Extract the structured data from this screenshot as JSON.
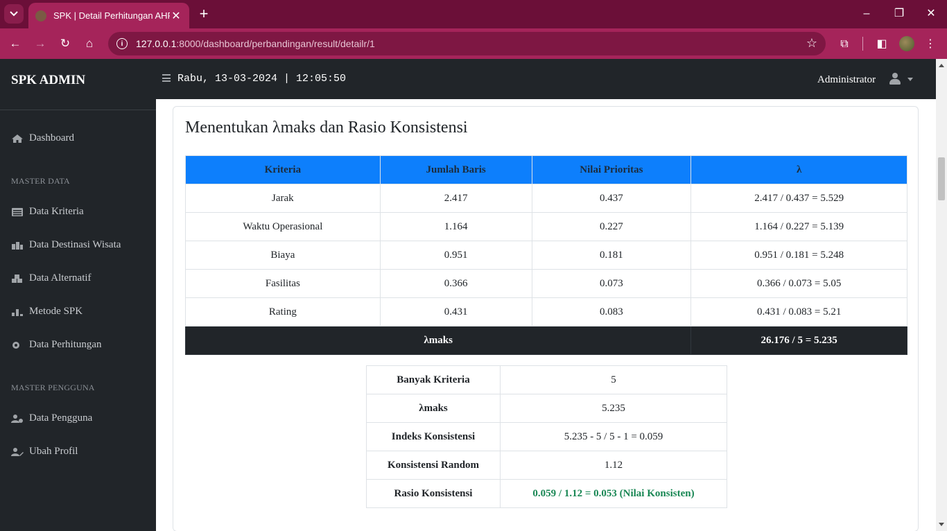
{
  "browser": {
    "tab_title": "SPK | Detail Perhitungan AHP",
    "url_host": "127.0.0.1",
    "url_rest": ":8000/dashboard/perbandingan/result/detailr/1"
  },
  "sidebar": {
    "brand": "SPK ADMIN",
    "dashboard": "Dashboard",
    "section_master_data": "MASTER DATA",
    "data_kriteria": "Data Kriteria",
    "data_destinasi": "Data Destinasi Wisata",
    "data_alternatif": "Data Alternatif",
    "metode_spk": "Metode SPK",
    "data_perhitungan": "Data Perhitungan",
    "section_master_pengguna": "MASTER PENGGUNA",
    "data_pengguna": "Data Pengguna",
    "ubah_profil": "Ubah Profil"
  },
  "topbar": {
    "clock": "Rabu, 13-03-2024 | 12:05:50",
    "user": "Administrator"
  },
  "card": {
    "title": "Menentukan λmaks dan Rasio Konsistensi"
  },
  "lambda_table": {
    "headers": [
      "Kriteria",
      "Jumlah Baris",
      "Nilai Prioritas",
      "λ"
    ],
    "rows": [
      [
        "Jarak",
        "2.417",
        "0.437",
        "2.417 / 0.437 = 5.529"
      ],
      [
        "Waktu Operasional",
        "1.164",
        "0.227",
        "1.164 / 0.227 = 5.139"
      ],
      [
        "Biaya",
        "0.951",
        "0.181",
        "0.951 / 0.181 = 5.248"
      ],
      [
        "Fasilitas",
        "0.366",
        "0.073",
        "0.366 / 0.073 = 5.05"
      ],
      [
        "Rating",
        "0.431",
        "0.083",
        "0.431 / 0.083 = 5.21"
      ]
    ],
    "footer_label": "λmaks",
    "footer_value": "26.176 / 5 = 5.235"
  },
  "summary_table": {
    "rows": [
      [
        "Banyak Kriteria",
        "5"
      ],
      [
        "λmaks",
        "5.235"
      ],
      [
        "Indeks Konsistensi",
        "5.235 - 5 / 5 - 1 = 0.059"
      ],
      [
        "Konsistensi Random",
        "1.12"
      ],
      [
        "Rasio Konsistensi",
        "0.059 / 1.12 = 0.053 (Nilai Konsisten)"
      ]
    ]
  }
}
